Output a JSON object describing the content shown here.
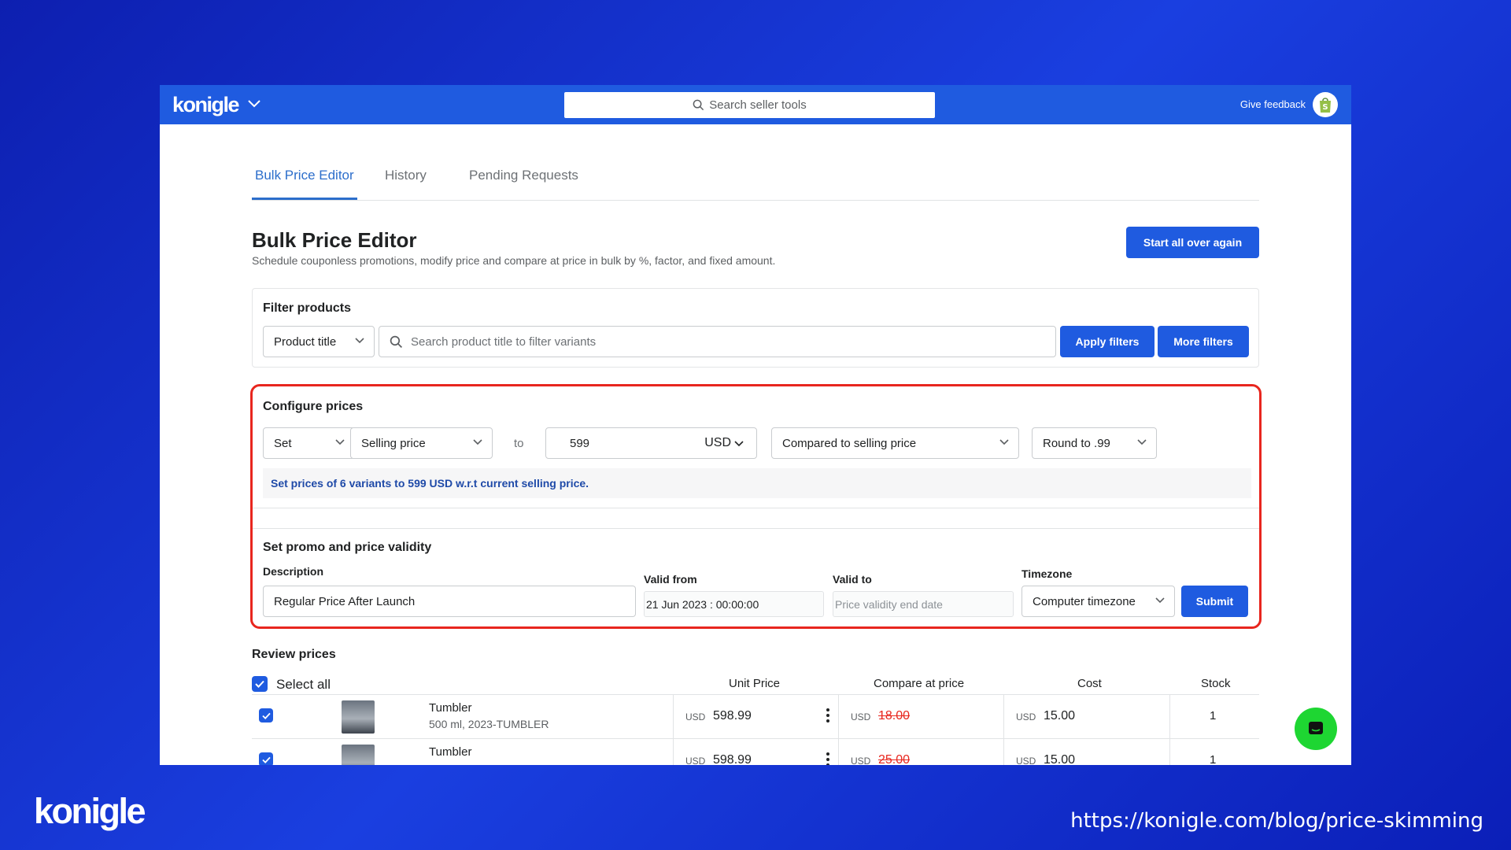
{
  "topbar": {
    "brand": "konigle",
    "search_placeholder": "Search seller tools",
    "feedback_label": "Give feedback"
  },
  "tabs": [
    {
      "label": "Bulk Price Editor",
      "active": true
    },
    {
      "label": "History",
      "active": false
    },
    {
      "label": "Pending Requests",
      "active": false
    }
  ],
  "page": {
    "title": "Bulk Price Editor",
    "subtitle": "Schedule couponless promotions, modify price and compare at price in bulk by %, factor, and fixed amount.",
    "start_over_label": "Start all over again"
  },
  "filter": {
    "title": "Filter products",
    "field_select": "Product title",
    "search_placeholder": "Search product title to filter variants",
    "apply_label": "Apply filters",
    "more_label": "More filters"
  },
  "configure": {
    "title": "Configure prices",
    "action": "Set",
    "target": "Selling price",
    "to_label": "to",
    "amount": "599",
    "currency": "USD",
    "comparison": "Compared to selling price",
    "rounding": "Round to .99",
    "summary": "Set prices of 6 variants to 599 USD w.r.t current selling price."
  },
  "promo": {
    "title": "Set promo and price validity",
    "description_label": "Description",
    "description_value": "Regular Price After Launch",
    "valid_from_label": "Valid from",
    "valid_from_value": "21 Jun 2023 : 00:00:00",
    "valid_to_label": "Valid to",
    "valid_to_placeholder": "Price validity end date",
    "timezone_label": "Timezone",
    "timezone_value": "Computer timezone",
    "submit_label": "Submit"
  },
  "review": {
    "title": "Review prices",
    "select_all_label": "Select all",
    "columns": {
      "unit_price": "Unit Price",
      "compare_at": "Compare at price",
      "cost": "Cost",
      "stock": "Stock"
    },
    "rows": [
      {
        "title": "Tumbler",
        "variant": "500 ml, 2023-TUMBLER",
        "currency": "USD",
        "unit_price": "598.99",
        "compare_at": "18.00",
        "cost": "15.00",
        "stock": "1"
      },
      {
        "title": "Tumbler",
        "variant": "",
        "currency": "USD",
        "unit_price": "598.99",
        "compare_at": "25.00",
        "cost": "15.00",
        "stock": "1"
      }
    ]
  },
  "footer": {
    "logo": "konigle",
    "url": "https://konigle.com/blog/price-skimming"
  },
  "colors": {
    "primary": "#1f5be0",
    "highlight_border": "#e8261e",
    "chat_fab": "#1ed632",
    "background": "#1a3fe0"
  }
}
